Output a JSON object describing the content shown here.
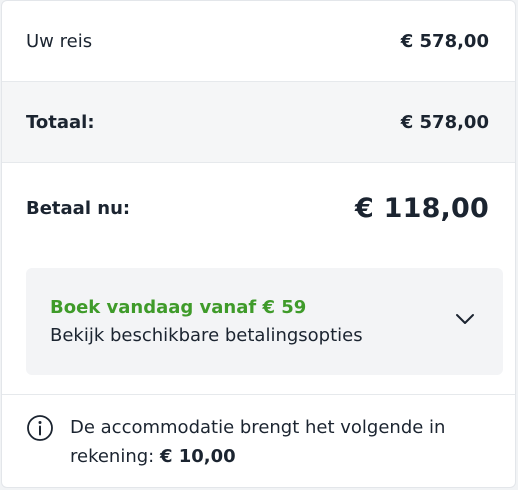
{
  "summary": {
    "trip_label": "Uw reis",
    "trip_amount": "€ 578,00",
    "total_label": "Totaal:",
    "total_amount": "€ 578,00",
    "pay_now_label": "Betaal nu:",
    "pay_now_amount": "€ 118,00"
  },
  "payment_offer": {
    "title": "Boek vandaag vanaf € 59",
    "subtitle": "Bekijk beschikbare betalingsopties",
    "icon": "chevron-down-icon"
  },
  "notice": {
    "icon": "info-circle-icon",
    "text": "De accommodatie brengt het volgende in rekening: ",
    "amount": "€ 10,00"
  },
  "colors": {
    "accent_green": "#3f9b2a",
    "text": "#1b2430",
    "panel": "#f3f4f6"
  }
}
